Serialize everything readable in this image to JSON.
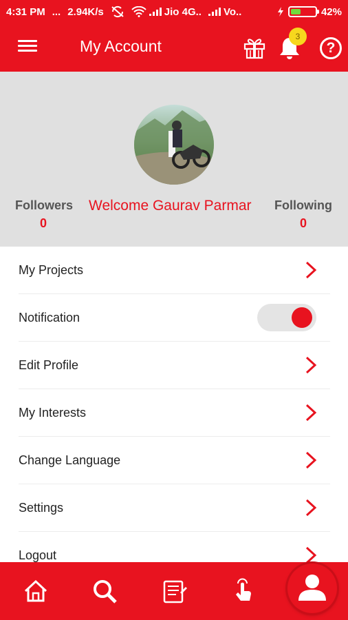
{
  "status_bar": {
    "time": "4:31 PM",
    "dots": "...",
    "speed": "2.94K/s",
    "carrier1": "Jio 4G..",
    "carrier2": "Vo..",
    "battery_percent": "42%",
    "battery_level": 0.42
  },
  "app_bar": {
    "title": "My Account",
    "notification_count": "3",
    "help_label": "?"
  },
  "profile": {
    "followers_label": "Followers",
    "followers_count": "0",
    "following_label": "Following",
    "following_count": "0",
    "welcome": "Welcome Gaurav Parmar"
  },
  "menu": {
    "items": [
      {
        "label": "My Projects"
      },
      {
        "label": "Notification",
        "toggle_on": true
      },
      {
        "label": "Edit Profile"
      },
      {
        "label": "My Interests"
      },
      {
        "label": "Change Language"
      },
      {
        "label": "Settings"
      },
      {
        "label": "Logout"
      }
    ]
  },
  "bottom_nav": {
    "icons": [
      "home-icon",
      "search-icon",
      "news-icon",
      "tap-icon",
      "profile-icon"
    ]
  },
  "colors": {
    "accent": "#e8131f",
    "header_bg": "#e0e0e0",
    "badge": "#f7d71e",
    "battery": "#6fdc3c"
  }
}
